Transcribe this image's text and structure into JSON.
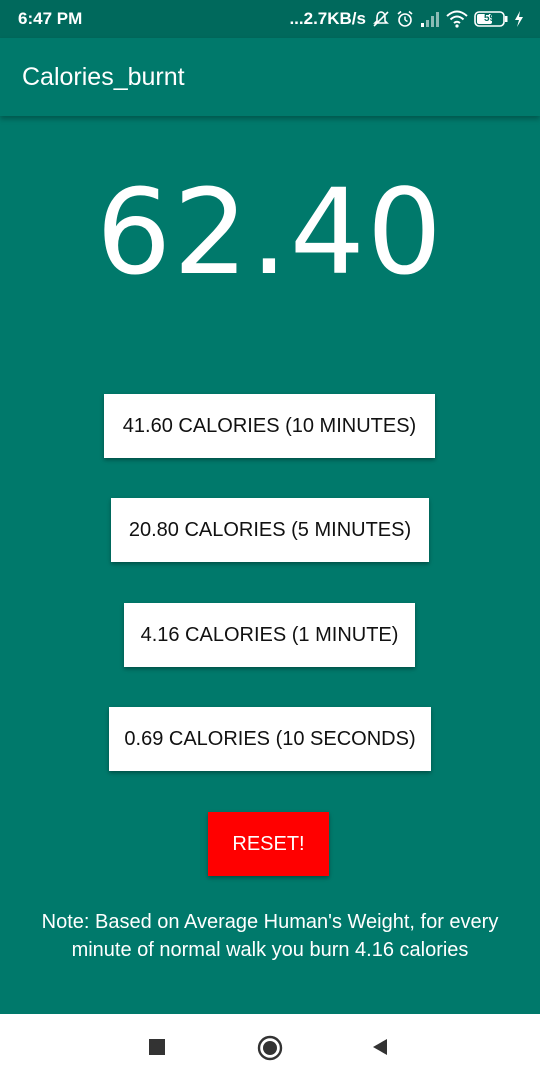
{
  "status_bar": {
    "time": "6:47 PM",
    "network_speed": "...2.7KB/s",
    "battery_level": "59",
    "icons": [
      "mute-icon",
      "alarm-icon",
      "signal-icon",
      "wifi-icon",
      "battery-icon",
      "charging-icon"
    ]
  },
  "app_bar": {
    "title": "Calories_burnt"
  },
  "counter": {
    "value": "62.40"
  },
  "buttons": {
    "ten_minutes": "41.60 CALORIES (10 MINUTES)",
    "five_minutes": "20.80 CALORIES (5 MINUTES)",
    "one_minute": "4.16 CALORIES (1 MINUTE)",
    "ten_seconds": "0.69 CALORIES (10 SECONDS)",
    "reset": "RESET!"
  },
  "note": "Note: Based on Average Human's Weight, for every minute of normal walk you burn 4.16 calories",
  "nav_bar": {
    "icons": [
      "recents-square-icon",
      "home-circle-icon",
      "back-triangle-icon"
    ]
  },
  "colors": {
    "primary": "#00796b",
    "status_bar": "#00695c",
    "reset": "#ff0000",
    "button_bg": "#ffffff"
  }
}
